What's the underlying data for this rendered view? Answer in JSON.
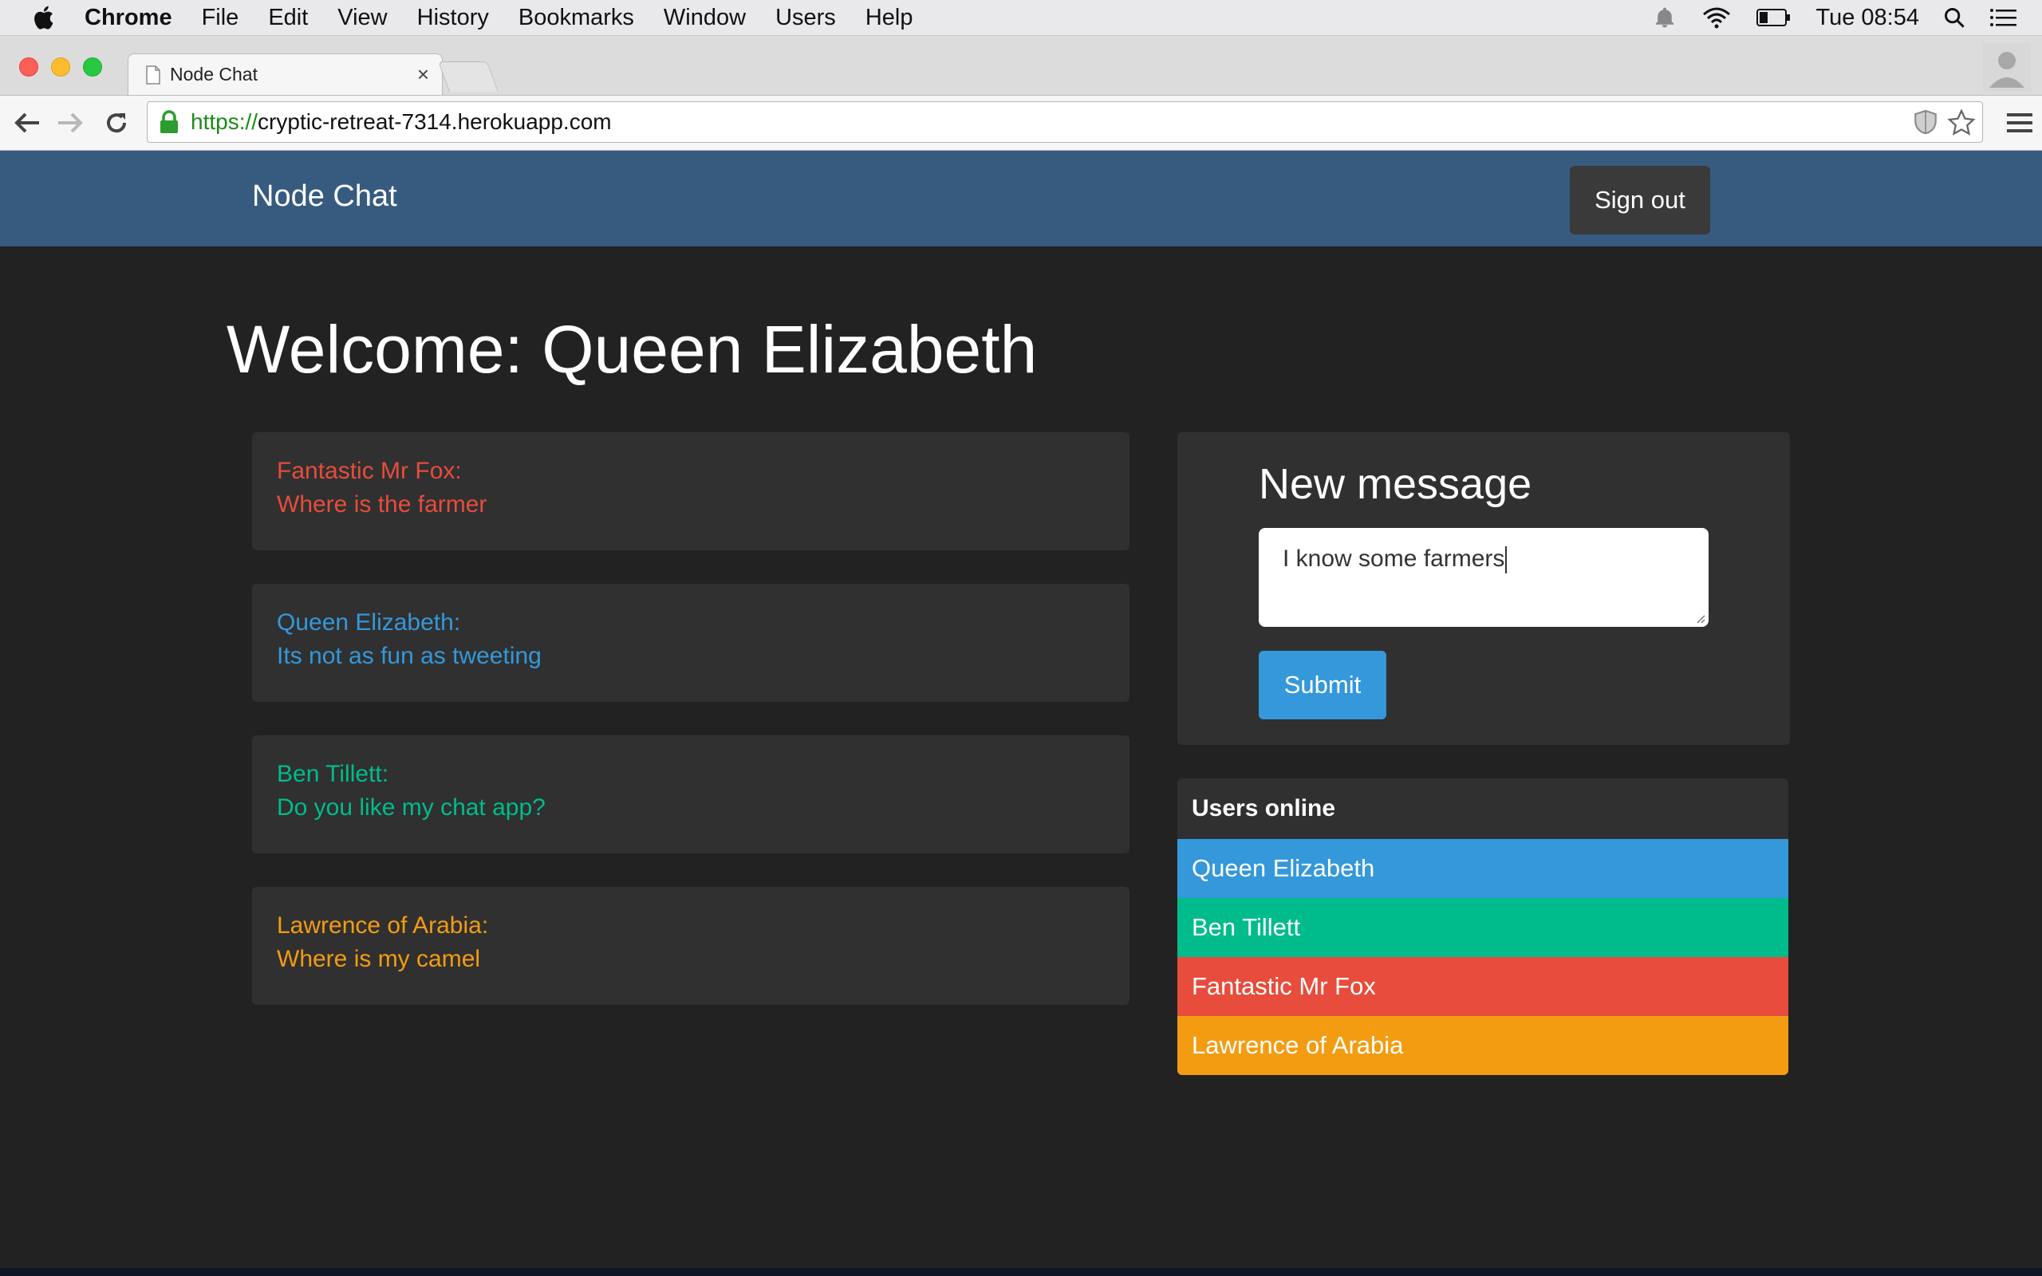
{
  "menubar": {
    "app_name": "Chrome",
    "items": [
      "File",
      "Edit",
      "View",
      "History",
      "Bookmarks",
      "Window",
      "Users",
      "Help"
    ],
    "clock": "Tue 08:54"
  },
  "browser": {
    "tab_title": "Node Chat",
    "tab_close": "×",
    "url_scheme": "https://",
    "url_host": "cryptic-retreat-7314.herokuapp.com"
  },
  "navbar": {
    "brand": "Node Chat",
    "signout_label": "Sign out"
  },
  "welcome": "Welcome: Queen Elizabeth",
  "messages": [
    {
      "author": "Fantastic Mr Fox:",
      "text": "Where is the farmer",
      "color": "#e74c3c"
    },
    {
      "author": "Queen Elizabeth:",
      "text": "Its not as fun as tweeting",
      "color": "#3498db"
    },
    {
      "author": "Ben Tillett:",
      "text": "Do you like my chat app?",
      "color": "#00bc8c"
    },
    {
      "author": "Lawrence of Arabia:",
      "text": "Where is my camel",
      "color": "#f39c12"
    }
  ],
  "new_message": {
    "heading": "New message",
    "value": "I know some farmers",
    "submit_label": "Submit"
  },
  "users_online": {
    "heading": "Users online",
    "users": [
      {
        "name": "Queen Elizabeth",
        "color": "#3498db"
      },
      {
        "name": "Ben Tillett",
        "color": "#00bc8c"
      },
      {
        "name": "Fantastic Mr Fox",
        "color": "#e74c3c"
      },
      {
        "name": "Lawrence of Arabia",
        "color": "#f39c12"
      }
    ]
  },
  "colors": {
    "page_bg": "#222222",
    "navbar_bg": "#375a7f",
    "card_bg": "#303030"
  }
}
